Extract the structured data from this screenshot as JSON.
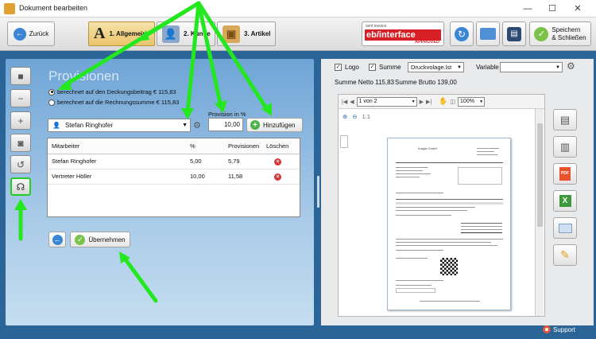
{
  "window": {
    "title": "Dokument bearbeiten",
    "minimize": "—",
    "maximize": "☐",
    "close": "✕"
  },
  "toolbar": {
    "back_label": "Zurück",
    "tabs": [
      {
        "label": "1. Allgemein",
        "icon": "A"
      },
      {
        "label": "2. Kunde"
      },
      {
        "label": "3. Artikel"
      }
    ],
    "ebinterface": {
      "small": "sent invoice",
      "eb": "eb",
      "rest": "/interface",
      "approved": "APPROVED"
    },
    "save_close_line1": "Speichern",
    "save_close_line2": "& Schließen"
  },
  "provisionen": {
    "title": "Provisionen",
    "option1": "berechnet auf den Deckungsbeitrag € 115,83",
    "option2": "berechnet auf die Rechnungssumme € 115,83",
    "selected_option": 1,
    "employee_select": "Stefan Ringhofer",
    "provision_label": "Provision in %",
    "provision_value": "10,00",
    "add_button": "Hinzufügen",
    "table": {
      "headers": [
        "Mitarbeiter",
        "%",
        "Provisionen",
        "Löschen"
      ],
      "rows": [
        {
          "name": "Stefan Ringhofer",
          "percent": "5,00",
          "amount": "5,79"
        },
        {
          "name": "Vertreter Höller",
          "percent": "10,00",
          "amount": "11,58"
        }
      ]
    },
    "apply_button": "Übernehmen"
  },
  "preview": {
    "logo_label": "Logo",
    "logo_checked": true,
    "summe_label": "Summe",
    "summe_checked": true,
    "template_select": "Druckvolage.lst",
    "variable_label": "Variable",
    "variable_value": "",
    "netto": "Summe Netto 115,83",
    "brutto": "Summe Brutto 139,00",
    "page_field": "1 von 2",
    "zoom": "100%",
    "zoom_ratio": "1:1",
    "doc_company": "Kragle GmbH"
  },
  "support_label": "Support",
  "colors": {
    "accent_green": "#24e81f",
    "window_blue": "#2b6496",
    "active_tab": "#e9c46d"
  }
}
